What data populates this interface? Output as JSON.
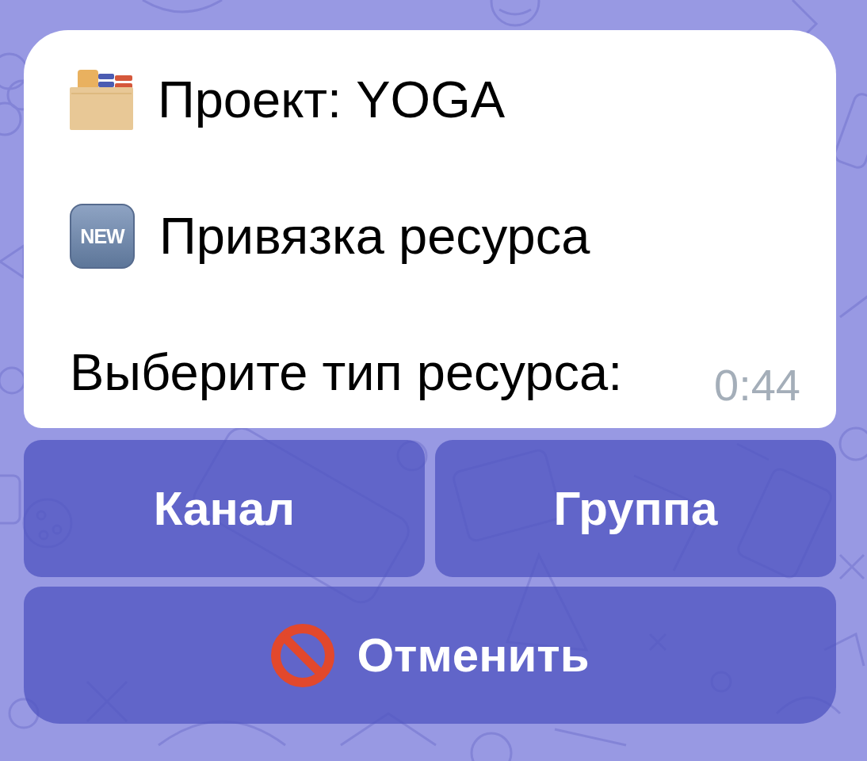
{
  "message": {
    "lines": [
      {
        "kind": "card-index",
        "text": "Проект: YOGA"
      },
      {
        "kind": "new",
        "badge": "NEW",
        "text": "Привязка ресурса"
      },
      {
        "kind": "plain",
        "text": "Выберите тип ресурса:"
      }
    ],
    "time": "0:44"
  },
  "keyboard": {
    "rows": [
      [
        {
          "kind": "plain",
          "label": "Канал"
        },
        {
          "kind": "plain",
          "label": "Группа"
        }
      ],
      [
        {
          "kind": "cancel",
          "label": "Отменить"
        }
      ]
    ]
  }
}
